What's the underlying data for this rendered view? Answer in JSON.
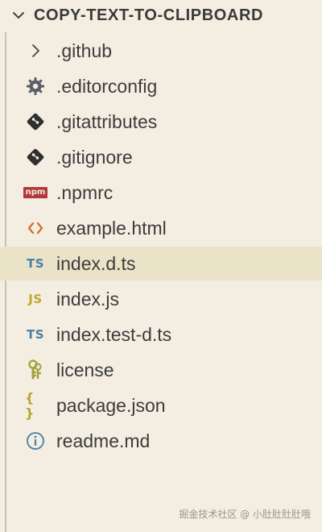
{
  "explorer": {
    "title": "COPY-TEXT-TO-CLIPBOARD",
    "items": [
      {
        "label": ".github",
        "icon": "chevron-right-icon"
      },
      {
        "label": ".editorconfig",
        "icon": "gear-icon"
      },
      {
        "label": ".gitattributes",
        "icon": "git-icon"
      },
      {
        "label": ".gitignore",
        "icon": "git-icon"
      },
      {
        "label": ".npmrc",
        "icon": "npm-icon"
      },
      {
        "label": "example.html",
        "icon": "html-code-icon"
      },
      {
        "label": "index.d.ts",
        "icon": "typescript-icon",
        "selected": true
      },
      {
        "label": "index.js",
        "icon": "javascript-icon"
      },
      {
        "label": "index.test-d.ts",
        "icon": "typescript-icon"
      },
      {
        "label": "license",
        "icon": "license-key-icon"
      },
      {
        "label": "package.json",
        "icon": "json-braces-icon"
      },
      {
        "label": "readme.md",
        "icon": "info-icon"
      }
    ],
    "icon_text": {
      "ts": "TS",
      "js": "JS",
      "npm": "npm",
      "braces": "{ }"
    }
  },
  "colors": {
    "background": "#f3eee1",
    "selected_row": "#ebe3c8",
    "typescript": "#4a7fa6",
    "javascript": "#c2a829",
    "html": "#d06a2e",
    "npm": "#b23a3a",
    "json": "#b9a32a",
    "license": "#a4a13c",
    "info": "#4a7fa6",
    "gear": "#5a5e66",
    "git": "#2f2f2f"
  },
  "watermark": "掘金技术社区 @ 小肚肚肚肚哦"
}
